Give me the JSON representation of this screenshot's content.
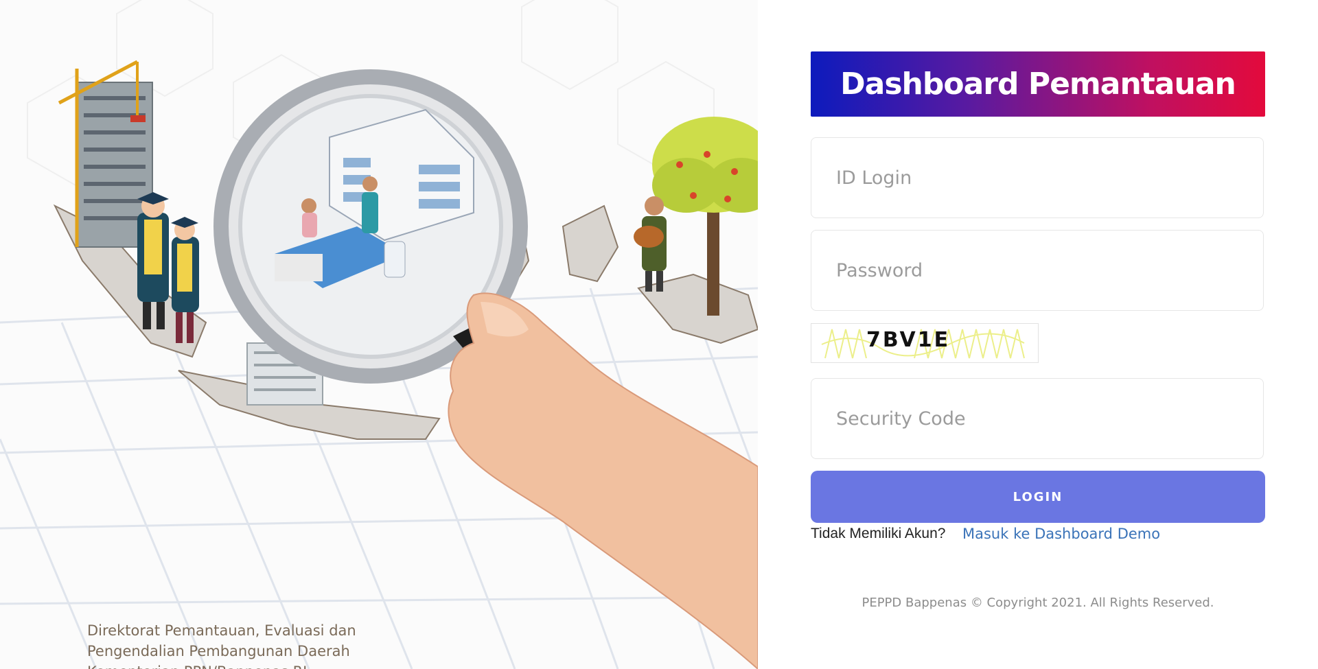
{
  "hero": {
    "caption_lines": [
      "Direktorat Pemantauan, Evaluasi dan",
      "Pengendalian Pembangunan Daerah",
      "Kementerian PPN/Bappenas RI"
    ]
  },
  "login": {
    "title": "Dashboard Pemantauan",
    "id_placeholder": "ID Login",
    "password_placeholder": "Password",
    "captcha_text": "7BV1E",
    "security_placeholder": "Security Code",
    "button_label": "LOGIN",
    "no_account_text": "Tidak Memiliki Akun?",
    "demo_link_text": "Masuk ke Dashboard Demo",
    "copyright": "PEPPD Bappenas © Copyright 2021. All Rights Reserved."
  },
  "colors": {
    "banner_start": "#0d1bbd",
    "banner_end": "#e30a3c",
    "button": "#6a76e2",
    "link": "#3a73b8"
  }
}
